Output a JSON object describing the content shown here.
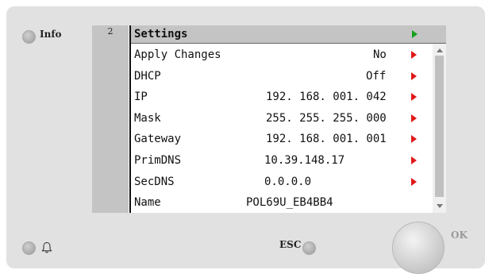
{
  "hardware": {
    "info_label": "Info",
    "esc_label": "ESC",
    "ok_label": "OK",
    "bell_icon": "bell-icon"
  },
  "screen": {
    "page_number": "2",
    "title": "Settings",
    "rows": [
      {
        "label": "Apply Changes",
        "value": "No"
      },
      {
        "label": "DHCP",
        "value": "Off"
      },
      {
        "label": "IP",
        "value": "192. 168. 001. 042"
      },
      {
        "label": "Mask",
        "value": "255. 255. 255. 000"
      },
      {
        "label": "Gateway",
        "value": "192. 168. 001. 001"
      },
      {
        "label": "PrimDNS",
        "value": "10.39.148.17"
      },
      {
        "label": "SecDNS",
        "value": "0.0.0.0"
      },
      {
        "label": "Name",
        "value": "POL69U_EB4BB4"
      }
    ]
  },
  "colors": {
    "edit_arrow": "#e01818",
    "title_arrow": "#16a01a",
    "panel": "#e1e1e1",
    "screen_header": "#c4c4c4"
  }
}
